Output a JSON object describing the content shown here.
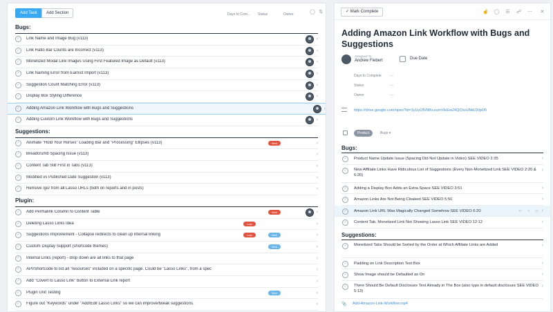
{
  "left": {
    "toolbar": {
      "add_task_label": "Add Task",
      "add_section_label": "Add Section",
      "columns": [
        "Days to Com...",
        "Status",
        "Owner"
      ]
    },
    "sections": [
      {
        "title": "Bugs:",
        "rows": [
          {
            "text": "Link Name and Image Bug (v113)",
            "avatar": true
          },
          {
            "text": "Link Ratio Bar Counts are Incorrect (v113)",
            "avatar": true
          },
          {
            "text": "Monetized Modal Link Images Using First Featured Image as Default (v113)",
            "avatar": true
          },
          {
            "text": "Link Naming Error from Earnist Import (v113)",
            "avatar": true
          },
          {
            "text": "Suggestion Count Matching Error (v113)",
            "avatar": true
          },
          {
            "text": "Display Box Styling Difference",
            "avatar": true
          },
          {
            "text": "Adding Amazon Link Workflow with Bugs and Suggestions",
            "avatar": true,
            "selected": true
          },
          {
            "text": "Adding Custom Link Workflow with Bugs and Suggestions",
            "avatar": true
          }
        ]
      },
      {
        "title": "Suggestions:",
        "rows": [
          {
            "text": "Animate \"Hold Your Horses\" Loading Bar and \"Processing\" Ellipses (v113)",
            "tag": "Med",
            "tagColor": "red",
            "avatar": false
          },
          {
            "text": "Breadcrumb Spacing Issue (v113)"
          },
          {
            "text": "Content Tab Still First in Tabs (v113)"
          },
          {
            "text": "Modified vs Published Date Suggestion (v113)"
          },
          {
            "text": "Remove /go/ from all Lasso URLs (both on reports and in posts)"
          }
        ]
      },
      {
        "title": "Plugin:",
        "rows": [
          {
            "text": "Add Permalink Column to Content Table",
            "tag": "Med",
            "tagColor": "red",
            "avatar": true
          },
          {
            "text": "Deleting Lasso Links Idea",
            "tag": "Low",
            "tagColor": "redl"
          },
          {
            "text": "Suggestions Improvement - Collapse redirects to clean up internal linking",
            "tag": "Low",
            "tagColor": "redl",
            "tag2": "Med",
            "tag2Color": "blue"
          },
          {
            "text": "Custom Display Support (shortcode themes)",
            "tag": "Med",
            "tagColor": "blue"
          },
          {
            "text": "Internal Links (report) - drop down are all links to that page"
          },
          {
            "text": "API/Shortcode to list all \"resources\" included on a specific page. Could be \"Lasso Links\", from a spec"
          },
          {
            "text": "Add \"Covert to Lasso Link\" button to External Link report"
          },
          {
            "text": "Plugin Unit Testing",
            "tag": "Med",
            "tagColor": "blue"
          },
          {
            "text": "Figure out \"Keywords\" under \"Add/Edit Lasso Links\" so we can improve/tweak suggestions."
          }
        ]
      }
    ]
  },
  "right": {
    "toolbar": {
      "mark_complete_label": "Mark Complete"
    },
    "title": "Adding Amazon Link Workflow with Bugs and Suggestions",
    "assigned_label": "Assigned To",
    "assignee": "Andrew Fiebert",
    "due_date_label": "Due Date",
    "fields": [
      {
        "label": "Days to Complete",
        "value": "—"
      },
      {
        "label": "Status",
        "value": "—"
      },
      {
        "label": "Owner",
        "value": "—"
      }
    ],
    "url": "https://drive.google.com/open?id=1yUyOfVMKczumVIeEw24QChoUMdJXlpO5",
    "project_tag": "Product",
    "project_section": "Bugs",
    "sections": [
      {
        "title": "Bugs:",
        "rows": [
          {
            "text": "Product Name Update Issue (Spacing Did Not Update in Video) SEE VIDEO 2:35"
          },
          {
            "text": "New Affiliate Links Have Ridiculous List of Suggestions (Every Non-Monetized Link SEE VIDEO 2:20 & 6:20)",
            "tall": true
          },
          {
            "text": "Adding a Display Box Adds an Extra Space SEE VIDEO 3:51"
          },
          {
            "text": "Amazon Links Are Not Being Cloaked SEE VIDEO 5:50"
          },
          {
            "text": "Amazon Link URL Was Magically Changed Somehow SEE VIDEO 6:20",
            "selected": true
          },
          {
            "text": "Content Tab, Monetized Link Not Showing Lasso Link SEE VIDEO 12:12"
          }
        ]
      },
      {
        "title": "Suggestions:",
        "rows": [
          {
            "text": "Monetized Tabs Should be Sorted by the Order at Which Affiliate Links are Added",
            "tall": true
          },
          {
            "text": "Padding on Link Description Text Box"
          },
          {
            "text": "Show Image should be Defaulted as On"
          },
          {
            "text": "There Should Be Default Disclosure Text Already in The Box (also typo in default disclosure SEE VIDEO 5:13)",
            "tall": true
          }
        ]
      }
    ],
    "attachment": "Add-Amazon-Link-Workflow.mp4"
  }
}
